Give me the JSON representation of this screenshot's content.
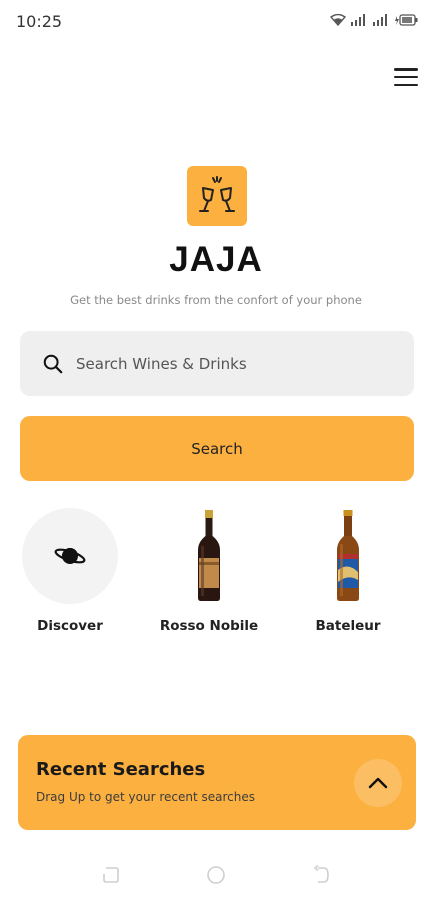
{
  "status_bar": {
    "time": "10:25"
  },
  "header": {
    "menu_icon": "hamburger-menu-icon"
  },
  "brand": {
    "logo_icon": "toast-glasses-icon",
    "title": "JAJA",
    "subtitle": "Get the best drinks from the confort of your phone",
    "accent_color": "#fbb040"
  },
  "search": {
    "placeholder": "Search Wines & Drinks",
    "value": "",
    "button_label": "Search"
  },
  "categories": [
    {
      "label": "Discover",
      "icon": "planet-icon"
    },
    {
      "label": "Rosso Nobile",
      "icon": "wine-bottle-image"
    },
    {
      "label": "Bateleur",
      "icon": "beer-bottle-image"
    }
  ],
  "recent_searches": {
    "title": "Recent Searches",
    "subtitle": "Drag Up to get your recent searches",
    "toggle_icon": "chevron-up-icon"
  }
}
